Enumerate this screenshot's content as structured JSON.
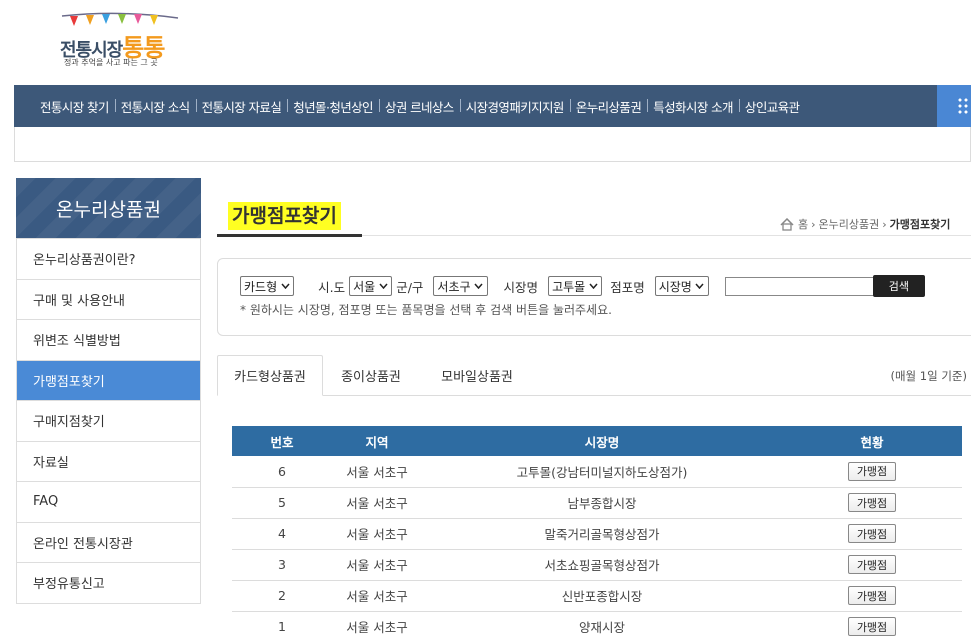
{
  "logo": {
    "main_prefix": "전통시장",
    "main_accent": "통통",
    "tagline": "정과 추억을 사고 파는 그 곳"
  },
  "gnb": [
    {
      "label": "전통시장 찾기"
    },
    {
      "label": "전통시장 소식"
    },
    {
      "label": "전통시장 자료실"
    },
    {
      "label": "청년몰·청년상인"
    },
    {
      "label": "상권 르네상스"
    },
    {
      "label": "시장경영패키지지원"
    },
    {
      "label": "온누리상품권"
    },
    {
      "label": "특성화시장 소개"
    },
    {
      "label": "상인교육관"
    }
  ],
  "lnb": {
    "title": "온누리상품권",
    "items": [
      {
        "label": "온누리상품권이란?"
      },
      {
        "label": "구매 및 사용안내"
      },
      {
        "label": "위변조 식별방법"
      },
      {
        "label": "가맹점포찾기"
      },
      {
        "label": "구매지점찾기"
      },
      {
        "label": "자료실"
      },
      {
        "label": "FAQ"
      },
      {
        "label": "온라인 전통시장관"
      },
      {
        "label": "부정유통신고"
      }
    ],
    "active_index": 3
  },
  "page_title": "가맹점포찾기",
  "breadcrumb": {
    "home": "홈",
    "parent": "온누리상품권",
    "current": "가맹점포찾기"
  },
  "search": {
    "type_select": "카드형",
    "sido_label": "시.도",
    "sido_select": "서울",
    "gugun_label": "군/구",
    "gugun_select": "서초구",
    "market_label": "시장명",
    "market_select": "고투몰",
    "store_label": "점포명",
    "store_select": "시장명",
    "keyword": "",
    "button": "검색",
    "note": "* 원하시는 시장명, 점포명 또는 품목명을 선택 후 검색 버튼을 눌러주세요."
  },
  "tabs": [
    {
      "label": "카드형상품권"
    },
    {
      "label": "종이상품권"
    },
    {
      "label": "모바일상품권"
    }
  ],
  "basis_note": "(매월 1일 기준)",
  "table": {
    "headers": [
      "번호",
      "지역",
      "시장명",
      "현황"
    ],
    "rows": [
      {
        "no": "6",
        "region": "서울 서초구",
        "market": "고투몰(강남터미널지하도상점가)",
        "status": "가맹점"
      },
      {
        "no": "5",
        "region": "서울 서초구",
        "market": "남부종합시장",
        "status": "가맹점"
      },
      {
        "no": "4",
        "region": "서울 서초구",
        "market": "말죽거리골목형상점가",
        "status": "가맹점"
      },
      {
        "no": "3",
        "region": "서울 서초구",
        "market": "서초쇼핑골목형상점가",
        "status": "가맹점"
      },
      {
        "no": "2",
        "region": "서울 서초구",
        "market": "신반포종합시장",
        "status": "가맹점"
      },
      {
        "no": "1",
        "region": "서울 서초구",
        "market": "양재시장",
        "status": "가맹점"
      }
    ]
  },
  "colors": {
    "gnb_bg": "#3d5879",
    "lnb_active": "#4a8ad6",
    "table_header": "#2e6ca2",
    "title_highlight": "#ffff22"
  }
}
